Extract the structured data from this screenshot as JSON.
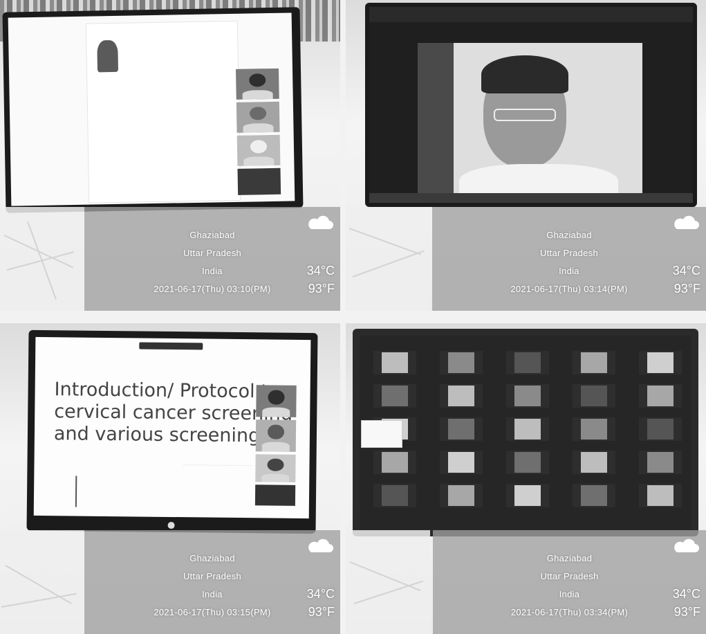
{
  "panels": [
    {
      "id": "top-left",
      "screen": {
        "slide_heading": "..."
      },
      "geotag": {
        "city": "Ghaziabad",
        "state": "Uttar Pradesh",
        "country": "India",
        "datetime": "2021-06-17(Thu) 03:10(PM)",
        "temp_c": "34°C",
        "temp_f": "93°F"
      }
    },
    {
      "id": "top-right",
      "geotag": {
        "city": "Ghaziabad",
        "state": "Uttar Pradesh",
        "country": "India",
        "datetime": "2021-06-17(Thu) 03:14(PM)",
        "temp_c": "34°C",
        "temp_f": "93°F"
      }
    },
    {
      "id": "bottom-left",
      "screen": {
        "slide_title_lines": [
          "Introduction/ Protocol to",
          "cervical cancer screening",
          "and various screening tes"
        ]
      },
      "geotag": {
        "city": "Ghaziabad",
        "state": "Uttar Pradesh",
        "country": "India",
        "datetime": "2021-06-17(Thu) 03:15(PM)",
        "temp_c": "34°C",
        "temp_f": "93°F"
      }
    },
    {
      "id": "bottom-right",
      "geotag": {
        "city": "Ghaziabad",
        "state": "Uttar Pradesh",
        "country": "India",
        "datetime": "2021-06-17(Thu) 03:34(PM)",
        "temp_c": "34°C",
        "temp_f": "93°F"
      }
    }
  ],
  "icons": {
    "weather": "cloud-icon",
    "map": "map-thumbnail"
  }
}
